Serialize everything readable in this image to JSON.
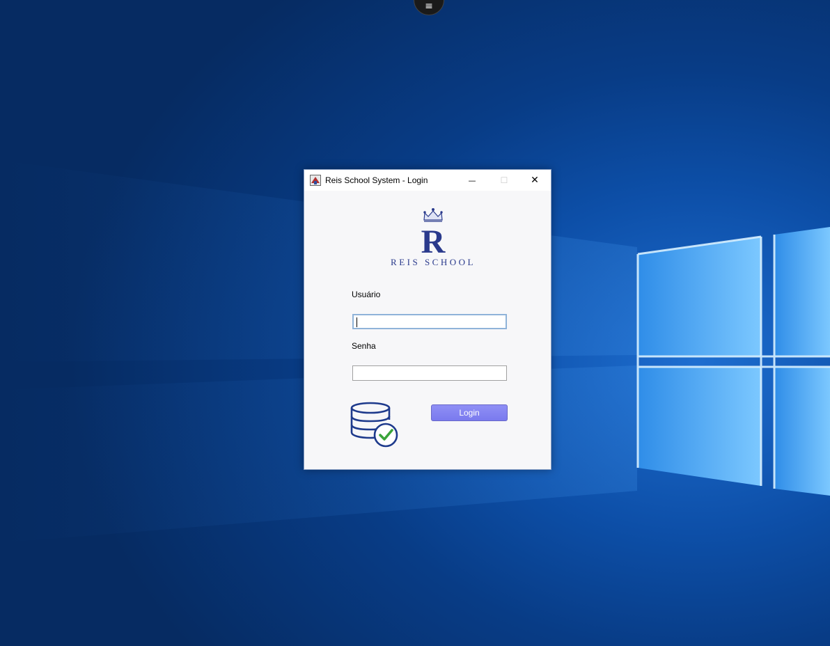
{
  "window": {
    "title": "Reis School System - Login",
    "minimize_glyph": "—",
    "maximize_glyph": "☐",
    "close_glyph": "✕"
  },
  "remote_menu": {
    "glyph": "≡"
  },
  "logo": {
    "letter": "R",
    "text": "REIS SCHOOL"
  },
  "form": {
    "user_label": "Usuário",
    "user_value": "",
    "password_label": "Senha",
    "password_value": "",
    "login_label": "Login"
  },
  "colors": {
    "accent": "#7b7bf0",
    "logo_blue": "#2a3a8c",
    "check_green": "#3aa43a"
  },
  "icons": [
    "app-icon",
    "crown-icon",
    "database-check-icon",
    "menu-icon",
    "minimize-icon",
    "maximize-icon",
    "close-icon"
  ]
}
